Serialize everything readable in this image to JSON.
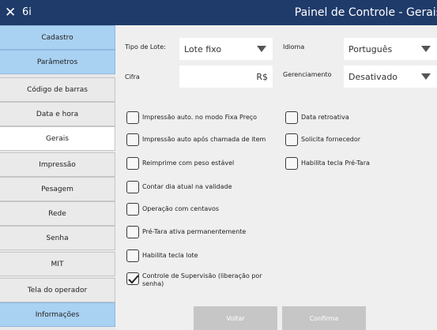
{
  "titlebar": {
    "close_glyph": "✕",
    "app_label": "6i",
    "title": "Painel de Controle - Gerais"
  },
  "sidebar": {
    "items": [
      {
        "label": "Cadastro",
        "style": "blue"
      },
      {
        "label": "Parâmetros",
        "style": "blue"
      },
      {
        "label": "Código de barras",
        "style": "gray"
      },
      {
        "label": "Data e hora",
        "style": "gray"
      },
      {
        "label": "Gerais",
        "style": "active"
      },
      {
        "label": "Impressão",
        "style": "gray"
      },
      {
        "label": "Pesagem",
        "style": "gray"
      },
      {
        "label": "Rede",
        "style": "gray"
      },
      {
        "label": "Senha",
        "style": "gray"
      },
      {
        "label": "MIT",
        "style": "gray"
      },
      {
        "label": "Tela do operador",
        "style": "gray"
      },
      {
        "label": "Informações",
        "style": "blue"
      }
    ]
  },
  "form": {
    "tipo_lote": {
      "label": "Tipo de Lote:",
      "value": "Lote fixo"
    },
    "idioma": {
      "label": "Idioma",
      "value": "Português"
    },
    "cifra": {
      "label": "Cifra",
      "value": "R$"
    },
    "gerenciamento": {
      "label": "Gerenciamento",
      "value": "Desativado"
    }
  },
  "checkboxes": [
    {
      "label": "Impressão auto. no modo Fixa Preço",
      "checked": false
    },
    {
      "label": "Impressão auto após chamada de item",
      "checked": false
    },
    {
      "label": "Reimprime com peso estável",
      "checked": false
    },
    {
      "label": "Contar dia atual na validade",
      "checked": false
    },
    {
      "label": "Operação com centavos",
      "checked": false
    },
    {
      "label": "Pré-Tara ativa permanentemente",
      "checked": false
    },
    {
      "label": "Habilita tecla lote",
      "checked": false
    },
    {
      "label": "Controle de Supervisão (liberação por senha)",
      "checked": true
    },
    {
      "label": "Data retroativa",
      "checked": false
    },
    {
      "label": "Solicita fornecedor",
      "checked": false
    },
    {
      "label": "Habilita tecla Pré-Tara",
      "checked": false
    }
  ],
  "buttons": {
    "back": "Voltar",
    "confirm": "Confirma"
  },
  "colors": {
    "titlebar": "#1f3b6a",
    "sidebar_blue": "#a9d1f2",
    "button_disabled": "#c6c6c6"
  }
}
